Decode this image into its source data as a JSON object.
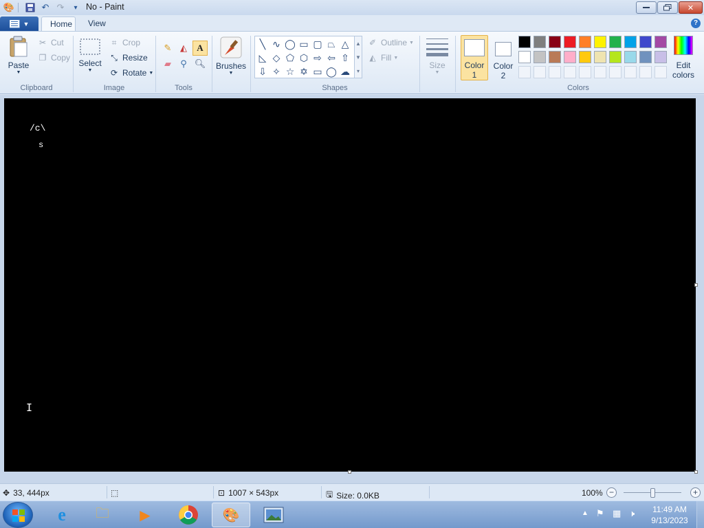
{
  "window": {
    "title": "No - Paint"
  },
  "tabs": {
    "home": "Home",
    "view": "View"
  },
  "ribbon": {
    "clipboard": {
      "label": "Clipboard",
      "paste": "Paste",
      "cut": "Cut",
      "copy": "Copy"
    },
    "image": {
      "label": "Image",
      "select": "Select",
      "crop": "Crop",
      "resize": "Resize",
      "rotate": "Rotate"
    },
    "tools": {
      "label": "Tools"
    },
    "brushes": {
      "label": "Brushes"
    },
    "shapes": {
      "label": "Shapes",
      "outline": "Outline",
      "fill": "Fill"
    },
    "size": {
      "label": "Size"
    },
    "colors": {
      "label": "Colors",
      "color1_line1": "Color",
      "color1_line2": "1",
      "color2_line1": "Color",
      "color2_line2": "2",
      "edit_line1": "Edit",
      "edit_line2": "colors",
      "palette_row1": [
        "#000000",
        "#7f7f7f",
        "#880015",
        "#ed1c24",
        "#ff7f27",
        "#fff200",
        "#22b14c",
        "#00a2e8",
        "#3f48cc",
        "#a349a4"
      ],
      "palette_row2": [
        "#ffffff",
        "#c3c3c3",
        "#b97a57",
        "#ffaec9",
        "#ffc90e",
        "#efe4b0",
        "#b5e61d",
        "#99d9ea",
        "#7092be",
        "#c8bfe7"
      ],
      "color1_value": "#ffffff",
      "color2_value": "#ffffff"
    }
  },
  "canvas": {
    "text_line1": "/c\\",
    "text_line2": "s"
  },
  "statusbar": {
    "cursor_pos": "33, 444px",
    "dimensions": "1007 × 543px",
    "size": "Size: 0.0KB",
    "zoom": "100%"
  },
  "taskbar": {
    "time": "11:49 AM",
    "date": "9/13/2023"
  }
}
